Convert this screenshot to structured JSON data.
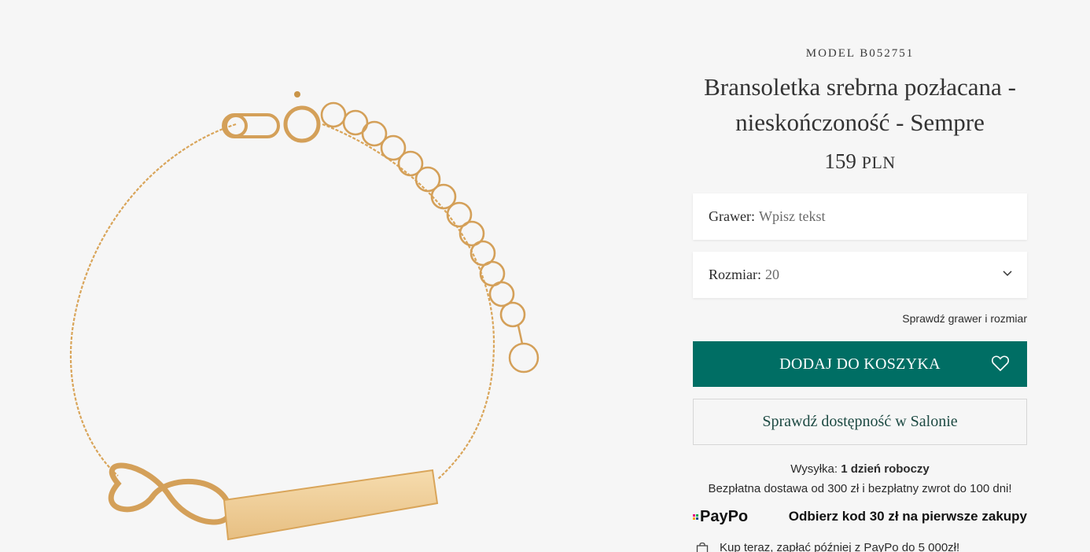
{
  "product": {
    "model": "MODEL B052751",
    "title_line1": "Bransoletka srebrna pozłacana -",
    "title_line2": "nieskończoność - Sempre",
    "price": "159",
    "currency": "PLN"
  },
  "engraving": {
    "label": "Grawer:",
    "placeholder": "Wpisz tekst"
  },
  "size": {
    "label": "Rozmiar:",
    "value": "20"
  },
  "check_link": "Sprawdź grawer i rozmiar",
  "add_to_cart": "DODAJ DO KOSZYKA",
  "availability": "Sprawdź dostępność w Salonie",
  "shipping": {
    "label": "Wysyłka:",
    "value": "1 dzień roboczy"
  },
  "delivery_info": "Bezpłatna dostawa od 300 zł i bezpłatny zwrot do 100 dni!",
  "paypo": {
    "logo": "PayPo",
    "promo": "Odbierz kod 30 zł na pierwsze zakupy",
    "paylater": "Kup teraz, zapłać później z PayPo do 5 000zł!"
  },
  "colors": {
    "accent": "#006e64",
    "gold": "#d9a55a",
    "background": "#f6f6f6"
  },
  "icons": {
    "heart": "heart-icon",
    "chevron": "chevron-down-icon",
    "bag": "shopping-bag-icon"
  }
}
